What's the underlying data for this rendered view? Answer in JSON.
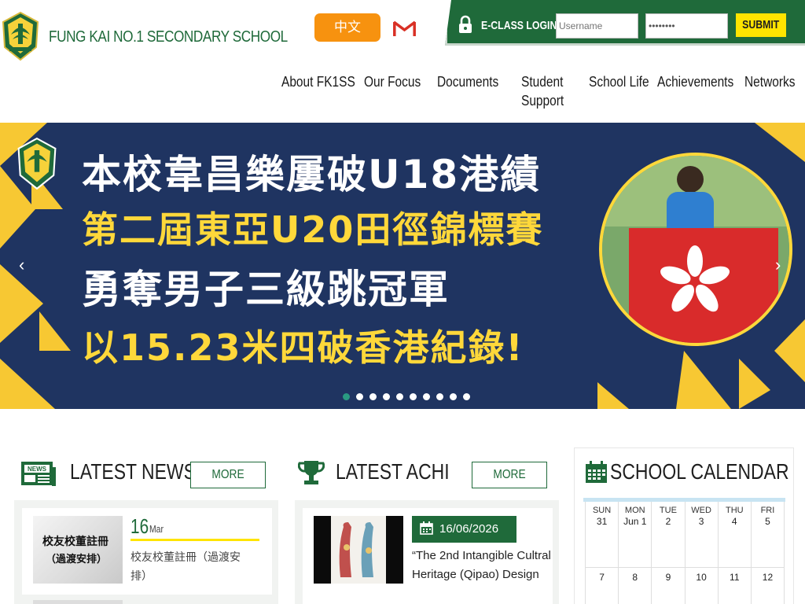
{
  "header": {
    "school_name": "FUNG KAI NO.1 SECONDARY SCHOOL",
    "lang_button": "中文",
    "eclass": {
      "label": "E-CLASS LOGIN:",
      "username_placeholder": "Username",
      "password_value": "••••••••",
      "submit_label": "SUBMIT"
    }
  },
  "nav": {
    "items": [
      {
        "label": "About FK1SS"
      },
      {
        "label": "Our Focus"
      },
      {
        "label": "Documents"
      },
      {
        "label": "Student"
      },
      {
        "label": "Support"
      },
      {
        "label": "School Life"
      },
      {
        "label": "Achievements"
      },
      {
        "label": "Networks"
      }
    ]
  },
  "banner": {
    "line1": "本校韋昌樂屢破U18港績",
    "line2": "第二屆東亞U20田徑錦標賽",
    "line3": "勇奪男子三級跳冠軍",
    "line4": "以15.23米四破香港紀錄!",
    "prev_arrow": "‹",
    "next_arrow": "›",
    "slide_count": 10,
    "active_slide": 1
  },
  "news": {
    "title": "LATEST NEWS",
    "more_label": "MORE",
    "item": {
      "thumb_line1": "校友校董註冊",
      "thumb_line2": "（過渡安排）",
      "day": "16",
      "month": "Mar",
      "text": "校友校董註冊（過渡安排）"
    }
  },
  "achievements": {
    "title": "LATEST ACHIEVEMENTS",
    "more_label": "MORE",
    "item": {
      "date": "16/06/2026",
      "text": "“The 2nd Intangible Cultral Heritage (Qipao) Design"
    }
  },
  "calendar": {
    "title": "SCHOOL CALENDAR",
    "week1": [
      {
        "day": "SUN",
        "num": "31"
      },
      {
        "day": "MON",
        "num": "Jun 1"
      },
      {
        "day": "TUE",
        "num": "2"
      },
      {
        "day": "WED",
        "num": "3"
      },
      {
        "day": "THU",
        "num": "4"
      },
      {
        "day": "FRI",
        "num": "5"
      }
    ],
    "week2": [
      "7",
      "8",
      "9",
      "10",
      "11",
      "12"
    ]
  },
  "colors": {
    "brand_green": "#1f6a3a",
    "accent_orange": "#f7920f",
    "accent_yellow": "#ffe400",
    "banner_navy": "#1f3461"
  }
}
